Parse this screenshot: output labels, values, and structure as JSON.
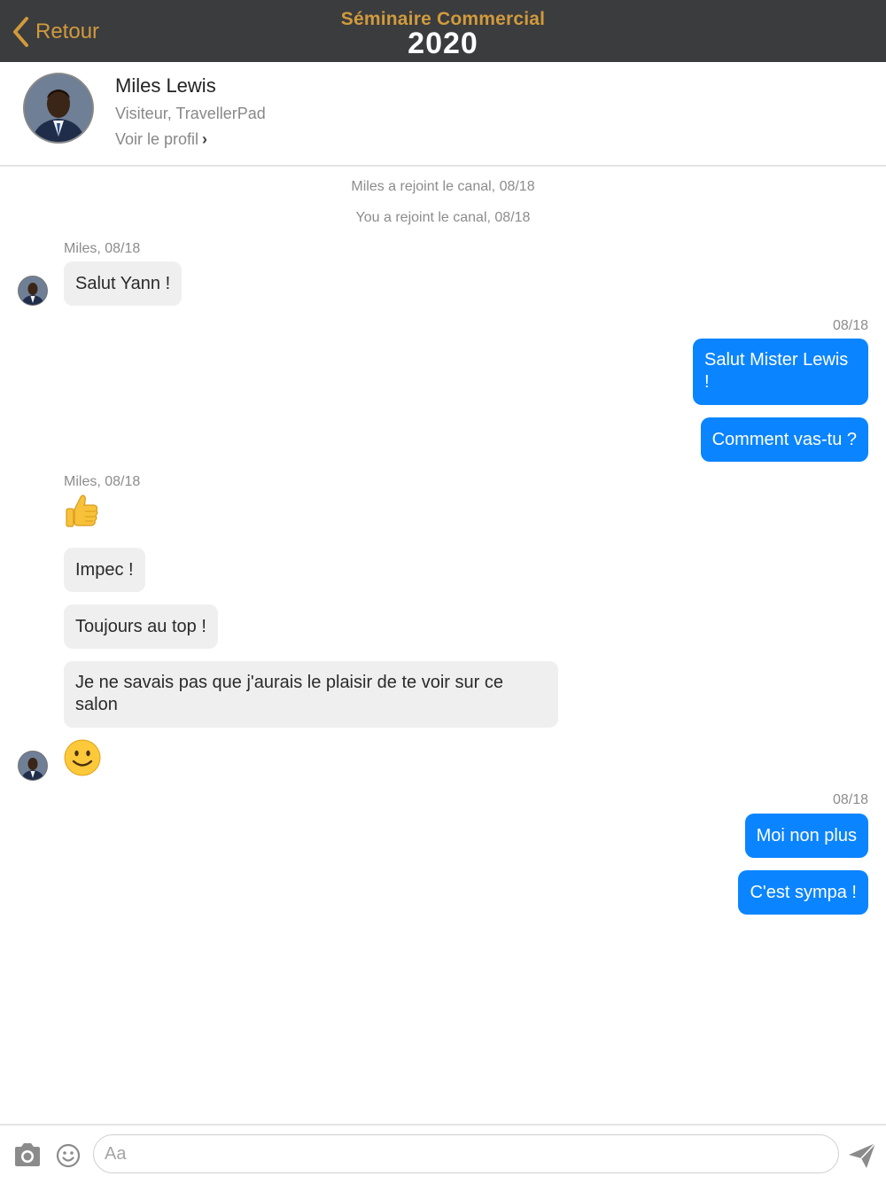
{
  "header": {
    "back_label": "Retour",
    "brand_line1": "Séminaire Commercial",
    "brand_line2": "2020"
  },
  "profile": {
    "name": "Miles Lewis",
    "role": "Visiteur, TravellerPad",
    "link_label": "Voir le profil"
  },
  "chat": {
    "system_messages": [
      "Miles a rejoint le canal, 08/18",
      "You a rejoint le canal, 08/18"
    ],
    "groups": [
      {
        "meta": "Miles, 08/18",
        "messages": [
          "Salut Yann !"
        ]
      },
      {
        "meta": "08/18",
        "messages": [
          "Salut Mister Lewis !",
          "Comment vas-tu ?"
        ]
      },
      {
        "meta": "Miles, 08/18",
        "messages": [
          "👍",
          "Impec !",
          "Toujours au top !",
          "Je ne savais pas que j'aurais le plaisir de te voir sur ce salon",
          "🙂"
        ]
      },
      {
        "meta": "08/18",
        "messages": [
          "Moi non plus",
          "C'est sympa !"
        ]
      }
    ]
  },
  "composer": {
    "placeholder": "Aa"
  },
  "colors": {
    "accent": "#d19a3c",
    "header_bg": "#3a3c3e",
    "outgoing": "#0b84ff",
    "incoming": "#efefef"
  }
}
